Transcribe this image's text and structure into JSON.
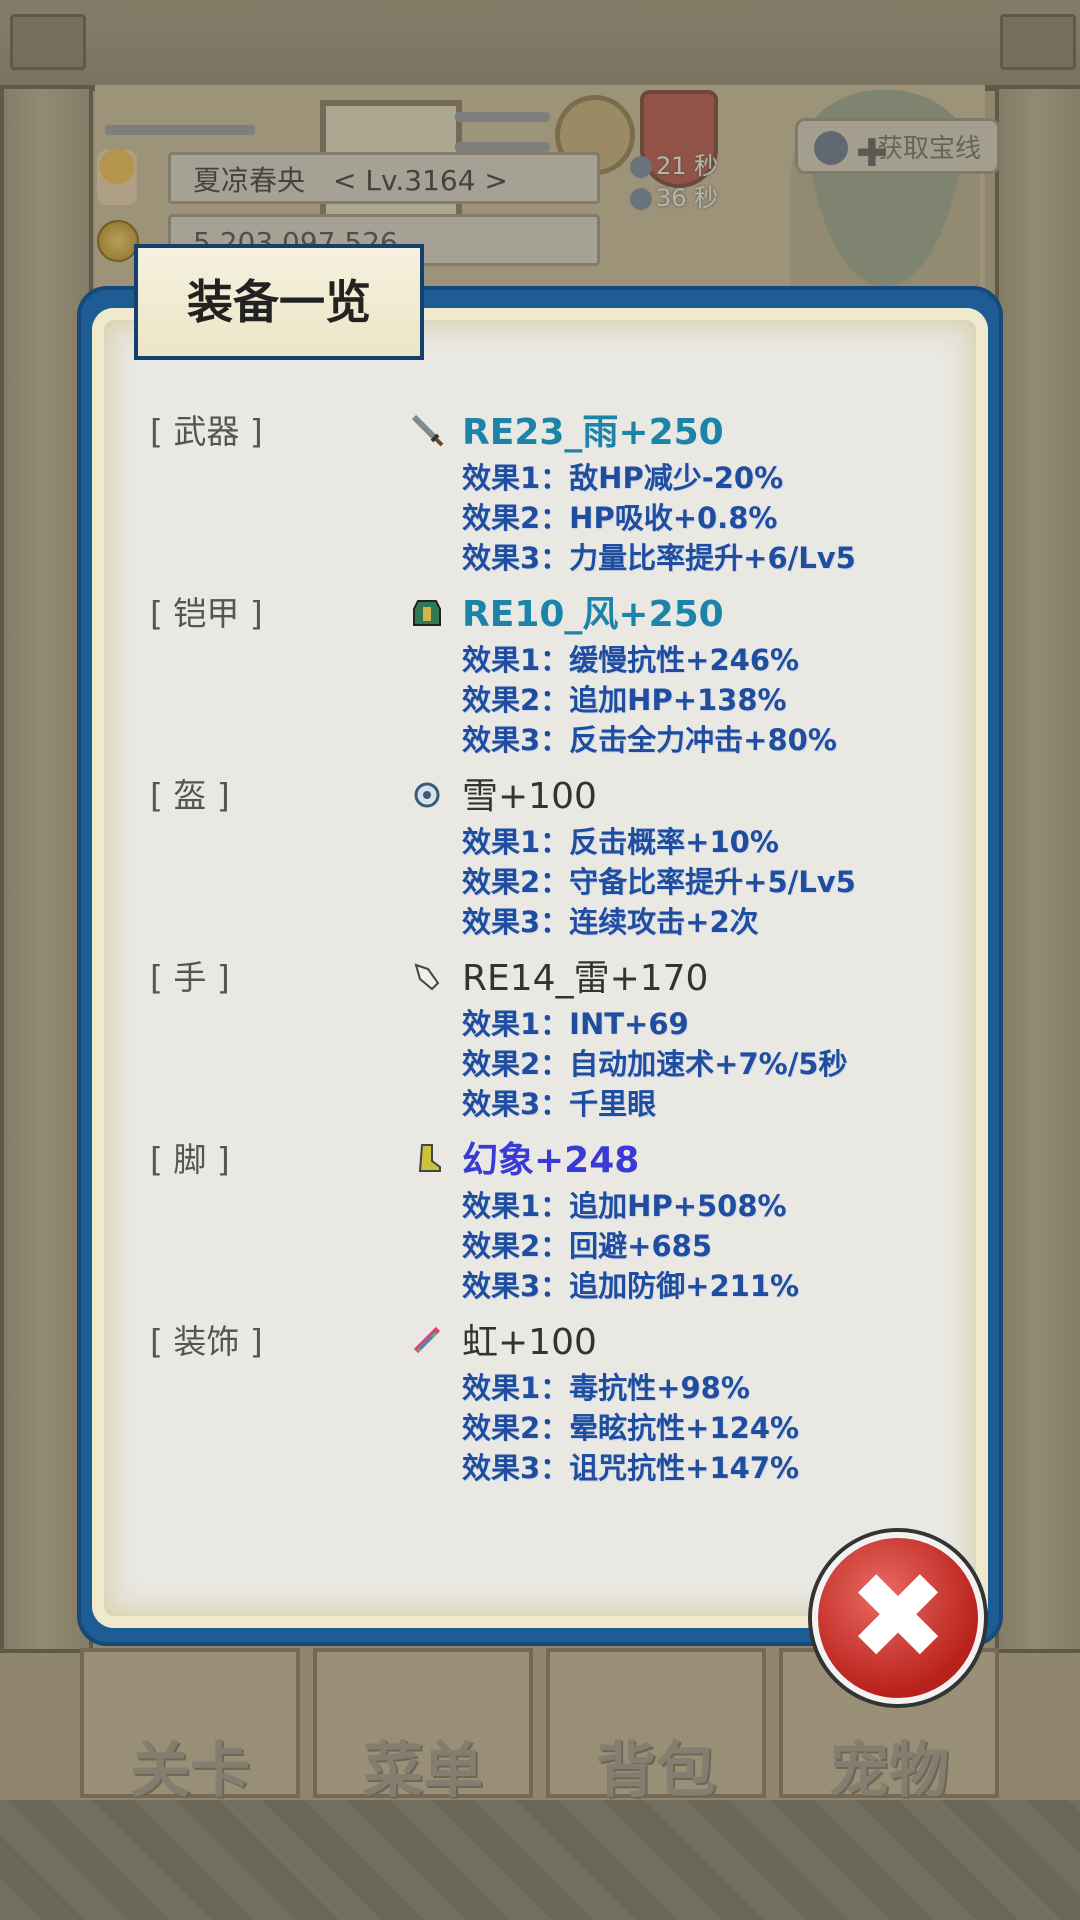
{
  "hud": {
    "player_name": "夏凉春央",
    "level": "< Lv.3164 >",
    "gold": "5 203 097 526",
    "timer1": "21 秒",
    "timer2": "36 秒",
    "treasure_button": "获取宝线"
  },
  "dialog": {
    "title": "装备一览",
    "slots": [
      {
        "label": "[ 武器 ]",
        "icon": "sword-icon",
        "name": "RE23_雨+250",
        "name_color": "#1b84a8",
        "effects": [
          "效果1：敌HP减少-20%",
          "效果2：HP吸收+0.8%",
          "效果3：力量比率提升+6/Lv5"
        ]
      },
      {
        "label": "[ 铠甲 ]",
        "icon": "armor-icon",
        "name": "RE10_风+250",
        "name_color": "#1b84a8",
        "effects": [
          "效果1：缓慢抗性+246%",
          "效果2：追加HP+138%",
          "效果3：反击全力冲击+80%"
        ]
      },
      {
        "label": "[ 盔 ]",
        "icon": "helmet-icon",
        "name": "雪+100",
        "name_color": "#333333",
        "effects": [
          "效果1：反击概率+10%",
          "效果2：守备比率提升+5/Lv5",
          "效果3：连续攻击+2次"
        ]
      },
      {
        "label": "[ 手 ]",
        "icon": "gauntlet-icon",
        "name": "RE14_雷+170",
        "name_color": "#333333",
        "effects": [
          "效果1：INT+69",
          "效果2：自动加速术+7%/5秒",
          "效果3：千里眼"
        ]
      },
      {
        "label": "[ 脚 ]",
        "icon": "boots-icon",
        "name": "幻象+248",
        "name_color": "#3a3ad6",
        "effects": [
          "效果1：追加HP+508%",
          "效果2：回避+685",
          "效果3：追加防御+211%"
        ]
      },
      {
        "label": "[ 装饰 ]",
        "icon": "rainbow-feather-icon",
        "name": "虹+100",
        "name_color": "#333333",
        "effects": [
          "效果1：毒抗性+98%",
          "效果2：晕眩抗性+124%",
          "效果3：诅咒抗性+147%"
        ]
      }
    ]
  },
  "bottom_nav": [
    "关卡",
    "菜单",
    "背包",
    "宠物"
  ],
  "colors": {
    "dialog_frame": "#1d5c94",
    "effect_text": "#1f4ea0",
    "close_button": "#c8302a"
  }
}
